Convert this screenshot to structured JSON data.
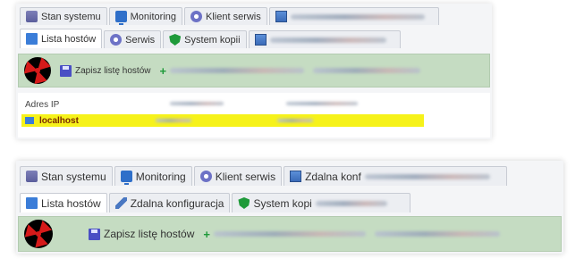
{
  "top_panel": {
    "tabs_row1": [
      {
        "label": "Stan systemu",
        "icon": "system-status-icon"
      },
      {
        "label": "Monitoring",
        "icon": "monitor-icon"
      },
      {
        "label": "Klient serwis",
        "icon": "gear-icon"
      },
      {
        "label": "",
        "icon": "remote-desktop-icon"
      }
    ],
    "tabs_row2": [
      {
        "label": "Lista hostów",
        "icon": "list-icon"
      },
      {
        "label": "Serwis",
        "icon": "gear-icon"
      },
      {
        "label": "System kopii",
        "icon": "shield-icon"
      },
      {
        "label": "",
        "icon": "remote-desktop-icon"
      }
    ],
    "toolbar": {
      "save_label": "Zapisz listę hostów",
      "add_symbol": "+"
    },
    "list": {
      "column_header": "Adres IP",
      "rows": [
        {
          "host": "localhost"
        }
      ]
    }
  },
  "bottom_panel": {
    "tabs_row1": [
      {
        "label": "Stan systemu",
        "icon": "system-status-icon"
      },
      {
        "label": "Monitoring",
        "icon": "monitor-icon"
      },
      {
        "label": "Klient serwis",
        "icon": "gear-icon"
      },
      {
        "label": "Zdalna konf",
        "icon": "remote-desktop-icon"
      }
    ],
    "tabs_row2": [
      {
        "label": "Lista hostów",
        "icon": "list-icon"
      },
      {
        "label": "Zdalna konfiguracja",
        "icon": "wrench-icon"
      },
      {
        "label": "System kopi",
        "icon": "shield-icon"
      }
    ],
    "toolbar": {
      "save_label": "Zapisz listę hostów",
      "add_symbol": "+"
    }
  },
  "colors": {
    "toolbar_bg": "#c5dcc2",
    "highlight_row": "#f6f21a",
    "brand_red": "#d61a1a"
  }
}
